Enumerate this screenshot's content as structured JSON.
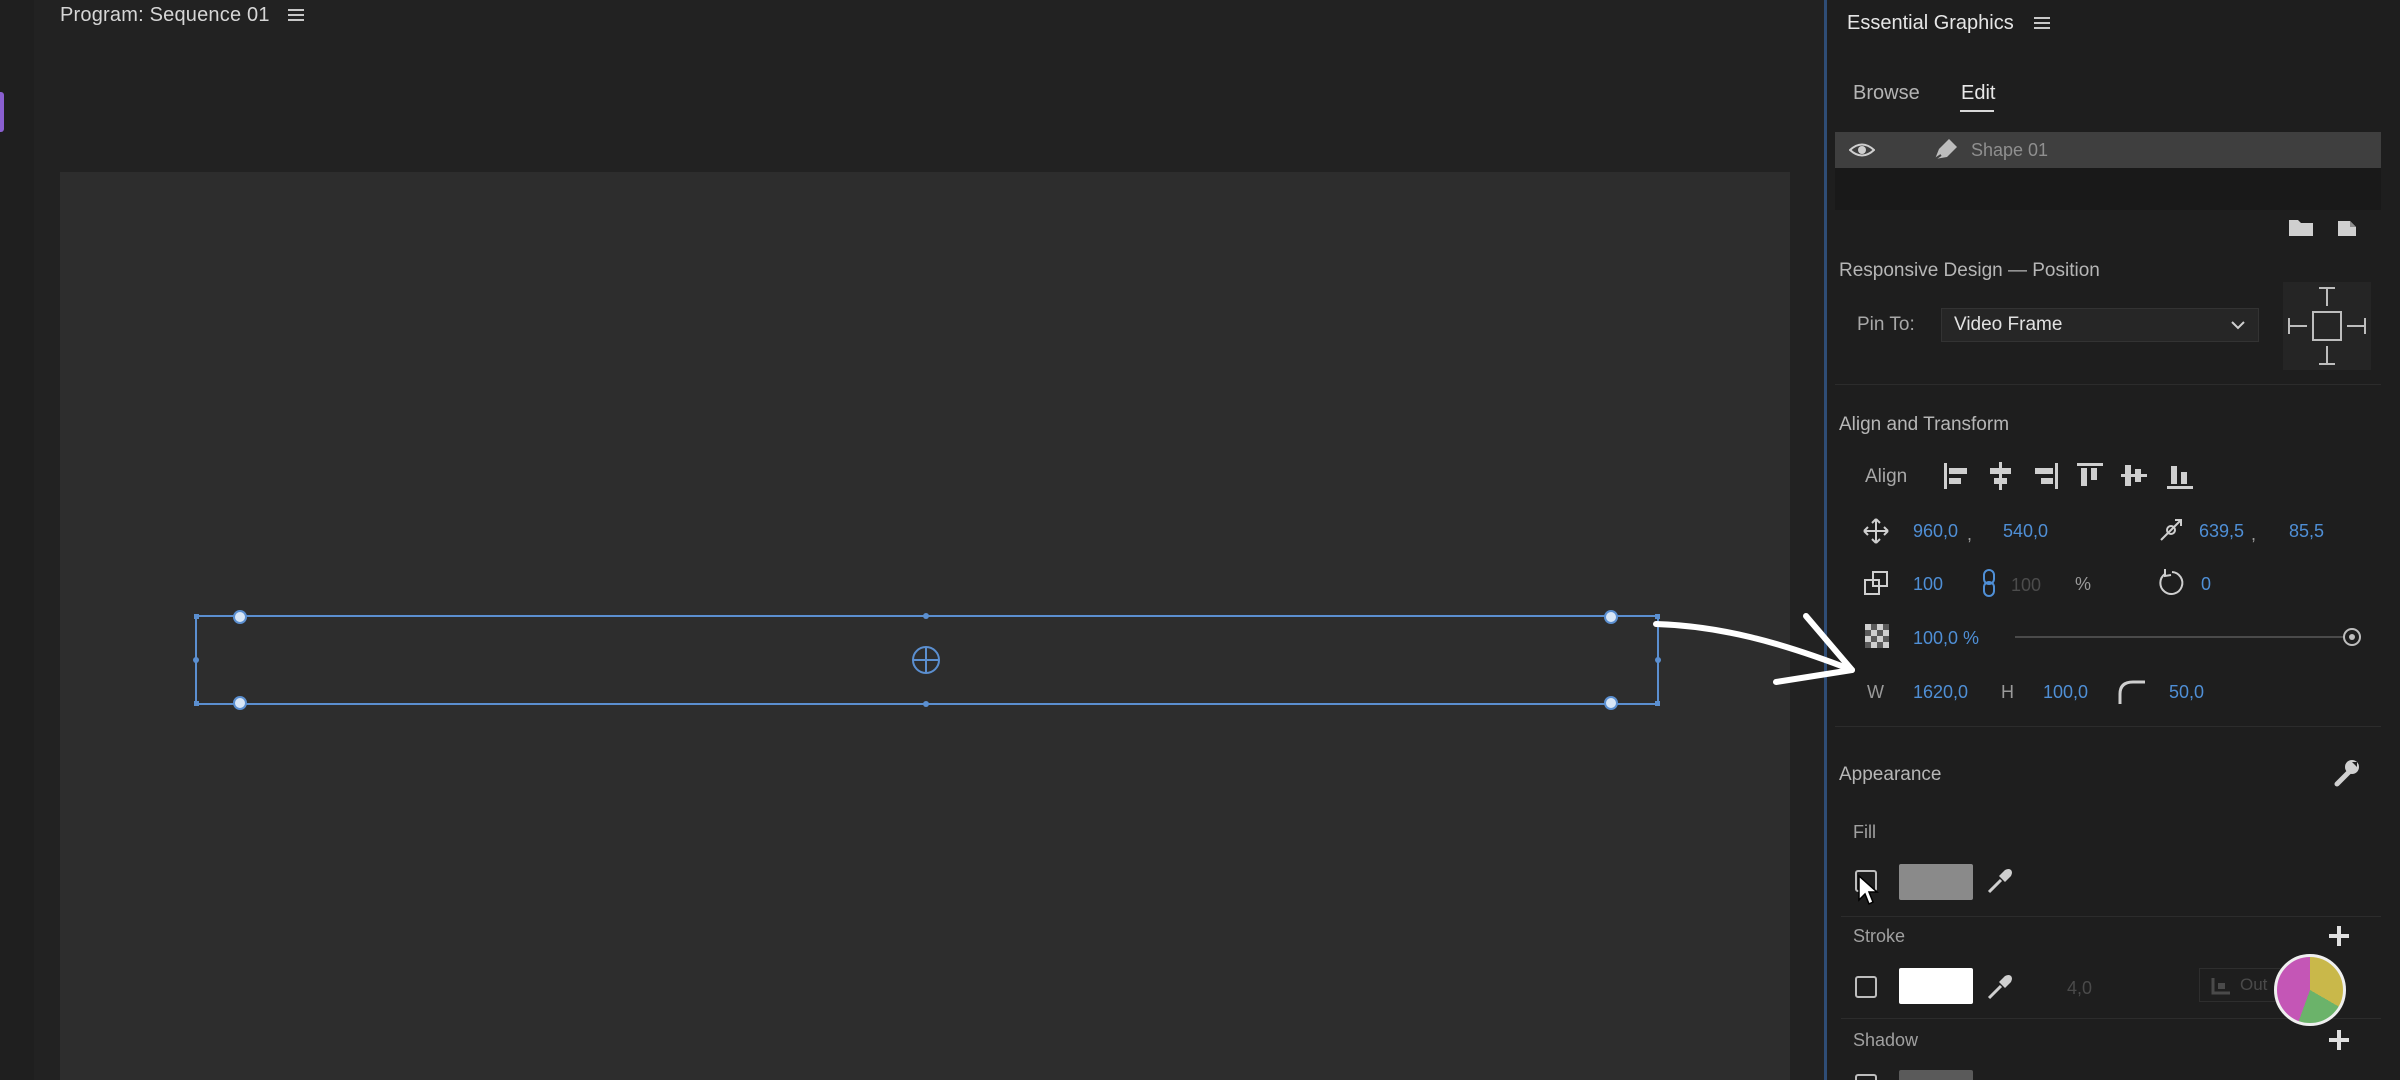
{
  "program": {
    "title": "Program: Sequence 01"
  },
  "essential_graphics": {
    "title": "Essential Graphics",
    "tabs": [
      {
        "label": "Browse",
        "active": false
      },
      {
        "label": "Edit",
        "active": true
      }
    ],
    "layer": {
      "name": "Shape 01"
    },
    "responsive_design": {
      "title": "Responsive Design — Position",
      "pin_to_label": "Pin To:",
      "pin_to_value": "Video Frame"
    },
    "align_transform": {
      "title": "Align and Transform",
      "align_label": "Align",
      "position": {
        "x": "960,0",
        "sep": ",",
        "y": "540,0"
      },
      "anchor": {
        "x": "639,5",
        "sep": ",",
        "y": "85,5"
      },
      "scale": {
        "value": "100",
        "linked_value": "100",
        "unit": "%"
      },
      "rotation": "0",
      "opacity": "100,0 %",
      "opacity_fraction": 1.0,
      "width_label": "W",
      "width": "1620,0",
      "height_label": "H",
      "height": "100,0",
      "corner_radius": "50,0"
    },
    "appearance": {
      "title": "Appearance",
      "fill_label": "Fill",
      "fill_checked": false,
      "fill_color": "#8a8a8a",
      "stroke_label": "Stroke",
      "stroke_checked": false,
      "stroke_color": "#ffffff",
      "stroke_width": "4,0",
      "stroke_type": "Out",
      "shadow_label": "Shadow"
    }
  },
  "colors": {
    "accent_blue": "#4f8fd6",
    "panel_border": "#2f4d76",
    "selection": "#5b8fd0"
  },
  "icons": [
    "hamburger-icon",
    "eye-icon",
    "pen-icon",
    "folder-icon",
    "new-layer-icon",
    "align-left-icon",
    "align-center-h-icon",
    "align-right-icon",
    "align-top-icon",
    "align-center-v-icon",
    "align-bottom-icon",
    "move-icon",
    "anchor-icon",
    "scale-icon",
    "link-icon",
    "rotate-icon",
    "opacity-icon",
    "corner-radius-icon",
    "wrench-icon",
    "eyedropper-icon",
    "plus-icon",
    "cursor-icon",
    "arrow-annotation"
  ]
}
